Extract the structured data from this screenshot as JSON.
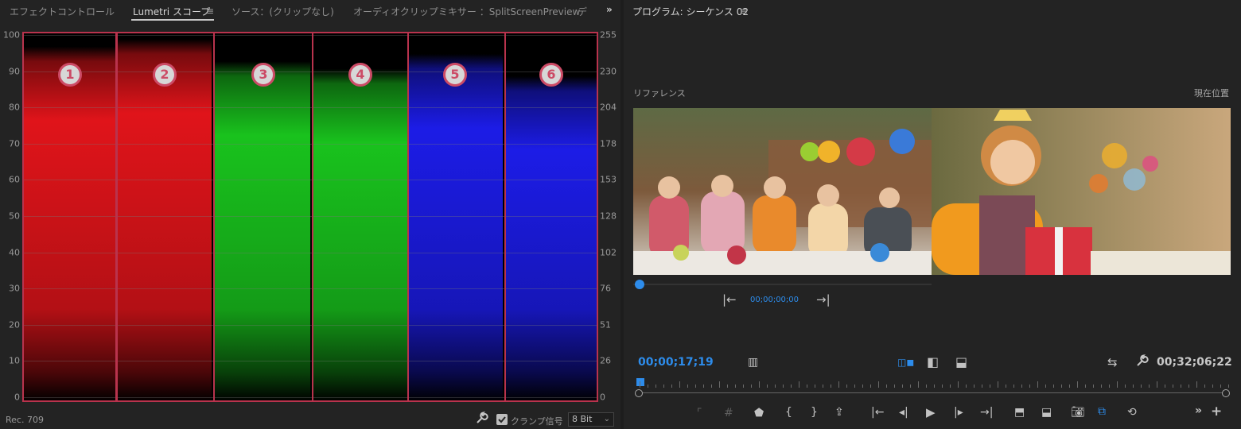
{
  "left_panel": {
    "tabs": [
      {
        "label": "エフェクトコントロール"
      },
      {
        "label": "Lumetri スコープ",
        "active": true
      },
      {
        "label": "ソース：(クリップなし)"
      },
      {
        "label": "オーディオクリップミキサー ：SplitScreenPreview"
      },
      {
        "label": "デ"
      }
    ],
    "menu_icon": "hamburger-menu-icon",
    "overflow_icon": "double-chevron-right-icon",
    "scope": {
      "left_axis": [
        "100",
        "90",
        "80",
        "70",
        "60",
        "50",
        "40",
        "30",
        "20",
        "10",
        "0"
      ],
      "right_axis": [
        "255",
        "230",
        "204",
        "178",
        "153",
        "128",
        "102",
        "76",
        "51",
        "26",
        "0"
      ],
      "segments": [
        {
          "badge": "1",
          "channel": "red",
          "color": "#e0141a",
          "level_top": 0.96
        },
        {
          "badge": "2",
          "channel": "red",
          "color": "#e0141a",
          "level_top": 0.98
        },
        {
          "badge": "3",
          "channel": "green",
          "color": "#19c21d",
          "level_top": 0.92
        },
        {
          "badge": "4",
          "channel": "green",
          "color": "#19c21d",
          "level_top": 0.9
        },
        {
          "badge": "5",
          "channel": "blue",
          "color": "#1c1ce6",
          "level_top": 0.94
        },
        {
          "badge": "6",
          "channel": "blue",
          "color": "#1c1ce6",
          "level_top": 0.88
        }
      ],
      "outline_color": "#b9334d"
    },
    "footer": {
      "colorspace": "Rec. 709",
      "clamp_label": "クランプ信号",
      "clamp_checked": true,
      "bit_depth": "8 Bit"
    }
  },
  "right_panel": {
    "title": "プログラム: シーケンス 02",
    "menu_icon": "hamburger-menu-icon",
    "reference_label": "リファレンス",
    "current_label": "現在位置",
    "reference_timecode": "00;00;00;00",
    "current_timecode": "00;00;17;19",
    "duration_timecode": "00;32;06;22",
    "accent_color": "#2d8ceb",
    "playhead_progress": 0.0
  }
}
